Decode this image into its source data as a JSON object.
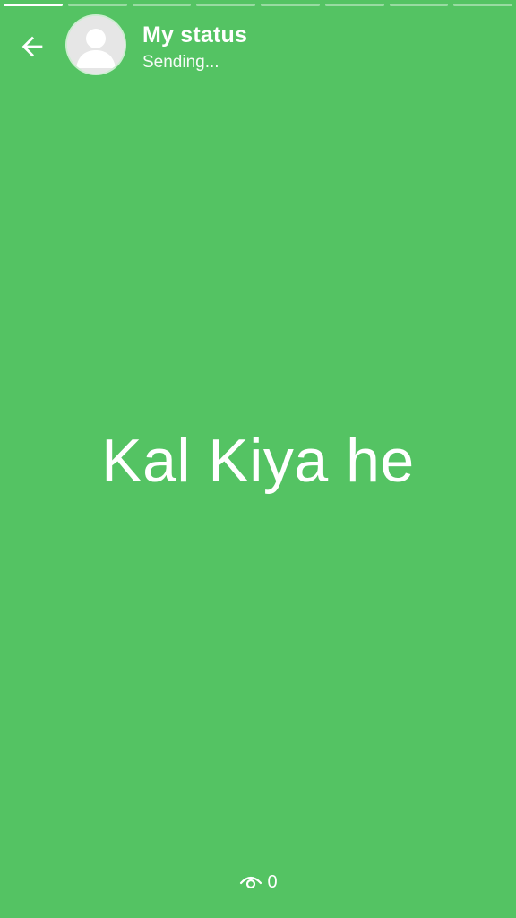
{
  "theme": {
    "background": "#54c363",
    "foreground": "#ffffff"
  },
  "progress": {
    "segments_total": 8,
    "current_index": 0,
    "current_fill": 1
  },
  "header": {
    "back_icon": "arrow-left-icon",
    "avatar_icon": "default-avatar-icon",
    "title": "My status",
    "subtitle": "Sending..."
  },
  "status": {
    "text": "Kal Kiya he"
  },
  "footer": {
    "views_icon": "eye-icon",
    "views_count": "0"
  }
}
